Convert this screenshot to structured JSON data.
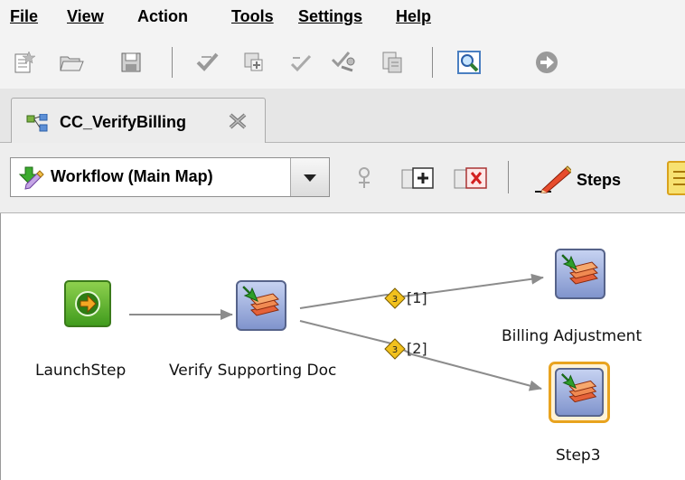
{
  "menu": {
    "file": "File",
    "view": "View",
    "action": "Action",
    "tools": "Tools",
    "settings": "Settings",
    "help": "Help"
  },
  "toolbar": {
    "icons": [
      "new-icon",
      "open-icon",
      "save-icon",
      "check-icon",
      "add-step-icon",
      "validate-icon",
      "tools-icon",
      "report-icon",
      "search-icon",
      "next-icon"
    ]
  },
  "tab": {
    "label": "CC_VerifyBilling"
  },
  "map_selector": {
    "selected": "Workflow (Main Map)"
  },
  "map_toolbar": {
    "steps_label": "Steps"
  },
  "workflow": {
    "nodes": {
      "launch": "LaunchStep",
      "verify": "Verify Supporting Doc",
      "billing": "Billing Adjustment",
      "step3": "Step3"
    },
    "edges": {
      "edge1": "[1]",
      "edge2": "[2]"
    }
  },
  "colors": {
    "selected_border": "#e8a31f",
    "launch_green": "#6cbf2a",
    "step_blue": "#8fa3d8"
  }
}
